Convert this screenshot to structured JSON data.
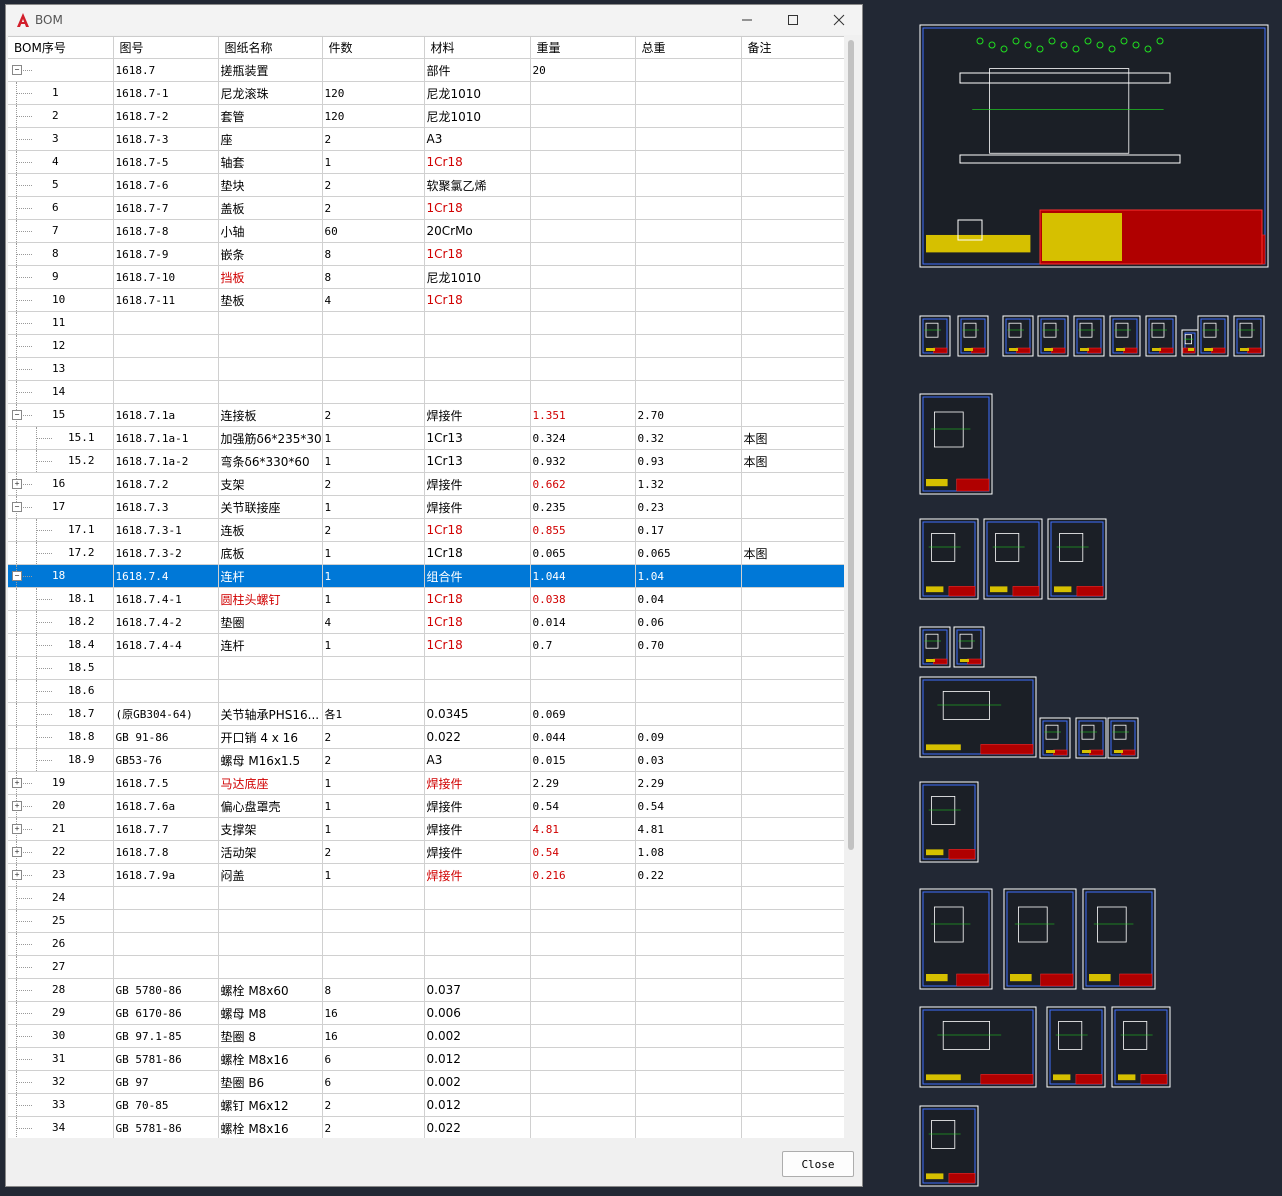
{
  "window": {
    "title": "BOM",
    "close_label": "Close"
  },
  "columns": [
    "BOM序号",
    "图号",
    "图纸名称",
    "件数",
    "材料",
    "重量",
    "总重",
    "备注"
  ],
  "rows": [
    {
      "lv": 0,
      "exp": "-",
      "seq": "",
      "dwg": "1618.7",
      "name": "搓瓶装置",
      "qty": "",
      "mat": "部件",
      "wt": "20",
      "tot": "",
      "note": ""
    },
    {
      "lv": 1,
      "seq": "1",
      "dwg": "1618.7-1",
      "name": "尼龙滚珠",
      "qty": "120",
      "mat": "尼龙1010",
      "wt": "",
      "tot": "",
      "note": ""
    },
    {
      "lv": 1,
      "seq": "2",
      "dwg": "1618.7-2",
      "name": "套管",
      "qty": "120",
      "mat": "尼龙1010",
      "wt": "",
      "tot": "",
      "note": ""
    },
    {
      "lv": 1,
      "seq": "3",
      "dwg": "1618.7-3",
      "name": "座",
      "qty": "2",
      "mat": "A3",
      "wt": "",
      "tot": "",
      "note": ""
    },
    {
      "lv": 1,
      "seq": "4",
      "dwg": "1618.7-5",
      "name": "轴套",
      "qty": "1",
      "mat": "1Cr18",
      "wt": "",
      "tot": "",
      "note": "",
      "red": [
        "mat"
      ]
    },
    {
      "lv": 1,
      "seq": "5",
      "dwg": "1618.7-6",
      "name": "垫块",
      "qty": "2",
      "mat": "软聚氯乙烯",
      "wt": "",
      "tot": "",
      "note": ""
    },
    {
      "lv": 1,
      "seq": "6",
      "dwg": "1618.7-7",
      "name": "盖板",
      "qty": "2",
      "mat": "1Cr18",
      "wt": "",
      "tot": "",
      "note": "",
      "red": [
        "mat"
      ]
    },
    {
      "lv": 1,
      "seq": "7",
      "dwg": "1618.7-8",
      "name": "小轴",
      "qty": "60",
      "mat": "20CrMo",
      "wt": "",
      "tot": "",
      "note": ""
    },
    {
      "lv": 1,
      "seq": "8",
      "dwg": "1618.7-9",
      "name": "嵌条",
      "qty": "8",
      "mat": "1Cr18",
      "wt": "",
      "tot": "",
      "note": "",
      "red": [
        "mat"
      ]
    },
    {
      "lv": 1,
      "seq": "9",
      "dwg": "1618.7-10",
      "name": "挡板",
      "qty": "8",
      "mat": "尼龙1010",
      "wt": "",
      "tot": "",
      "note": "",
      "red": [
        "name"
      ]
    },
    {
      "lv": 1,
      "seq": "10",
      "dwg": "1618.7-11",
      "name": "垫板",
      "qty": "4",
      "mat": "1Cr18",
      "wt": "",
      "tot": "",
      "note": "",
      "red": [
        "mat"
      ]
    },
    {
      "lv": 1,
      "seq": "11",
      "dwg": "",
      "name": "",
      "qty": "",
      "mat": "",
      "wt": "",
      "tot": "",
      "note": ""
    },
    {
      "lv": 1,
      "seq": "12",
      "dwg": "",
      "name": "",
      "qty": "",
      "mat": "",
      "wt": "",
      "tot": "",
      "note": ""
    },
    {
      "lv": 1,
      "seq": "13",
      "dwg": "",
      "name": "",
      "qty": "",
      "mat": "",
      "wt": "",
      "tot": "",
      "note": ""
    },
    {
      "lv": 1,
      "seq": "14",
      "dwg": "",
      "name": "",
      "qty": "",
      "mat": "",
      "wt": "",
      "tot": "",
      "note": ""
    },
    {
      "lv": 1,
      "exp": "-",
      "seq": "15",
      "dwg": "1618.7.1a",
      "name": "连接板",
      "qty": "2",
      "mat": "焊接件",
      "wt": "1.351",
      "tot": "2.70",
      "note": "",
      "red": [
        "wt"
      ]
    },
    {
      "lv": 2,
      "seq": "15.1",
      "dwg": "1618.7.1a-1",
      "name": "加强筋δ6*235*30",
      "qty": "1",
      "mat": "1Cr13",
      "wt": "0.324",
      "tot": "0.32",
      "note": "本图"
    },
    {
      "lv": 2,
      "seq": "15.2",
      "dwg": "1618.7.1a-2",
      "name": "弯条δ6*330*60",
      "qty": "1",
      "mat": "1Cr13",
      "wt": "0.932",
      "tot": "0.93",
      "note": "本图"
    },
    {
      "lv": 1,
      "exp": "+",
      "seq": "16",
      "dwg": "1618.7.2",
      "name": "支架",
      "qty": "2",
      "mat": "焊接件",
      "wt": "0.662",
      "tot": "1.32",
      "note": "",
      "red": [
        "wt"
      ]
    },
    {
      "lv": 1,
      "exp": "-",
      "seq": "17",
      "dwg": "1618.7.3",
      "name": "关节联接座",
      "qty": "1",
      "mat": "焊接件",
      "wt": "0.235",
      "tot": "0.23",
      "note": ""
    },
    {
      "lv": 2,
      "seq": "17.1",
      "dwg": "1618.7.3-1",
      "name": "连板",
      "qty": "2",
      "mat": "1Cr18",
      "wt": "0.855",
      "tot": "0.17",
      "note": "",
      "red": [
        "mat",
        "wt"
      ]
    },
    {
      "lv": 2,
      "seq": "17.2",
      "dwg": "1618.7.3-2",
      "name": "底板",
      "qty": "1",
      "mat": "1Cr18",
      "wt": "0.065",
      "tot": "0.065",
      "note": "本图"
    },
    {
      "lv": 1,
      "exp": "-",
      "sel": true,
      "seq": "18",
      "dwg": "1618.7.4",
      "name": "连杆",
      "qty": "1",
      "mat": "组合件",
      "wt": "1.044",
      "tot": "1.04",
      "note": ""
    },
    {
      "lv": 2,
      "seq": "18.1",
      "dwg": "1618.7.4-1",
      "name": "圆柱头螺钉",
      "qty": "1",
      "mat": "1Cr18",
      "wt": "0.038",
      "tot": "0.04",
      "note": "",
      "red": [
        "name",
        "mat",
        "wt"
      ]
    },
    {
      "lv": 2,
      "seq": "18.2",
      "dwg": "1618.7.4-2",
      "name": "垫圈",
      "qty": "4",
      "mat": "1Cr18",
      "wt": "0.014",
      "tot": "0.06",
      "note": "",
      "red": [
        "mat"
      ]
    },
    {
      "lv": 2,
      "seq": "18.4",
      "dwg": "1618.7.4-4",
      "name": "连杆",
      "qty": "1",
      "mat": "1Cr18",
      "wt": "0.7",
      "tot": "0.70",
      "note": "",
      "red": [
        "mat"
      ]
    },
    {
      "lv": 2,
      "seq": "18.5",
      "dwg": "",
      "name": "",
      "qty": "",
      "mat": "",
      "wt": "",
      "tot": "",
      "note": ""
    },
    {
      "lv": 2,
      "seq": "18.6",
      "dwg": "",
      "name": "",
      "qty": "",
      "mat": "",
      "wt": "",
      "tot": "",
      "note": ""
    },
    {
      "lv": 2,
      "seq": "18.7",
      "dwg": "(原GB304-64)",
      "name": "关节轴承PHS16...",
      "qty": "各1",
      "mat": "0.0345",
      "wt": "0.069",
      "tot": "",
      "note": ""
    },
    {
      "lv": 2,
      "seq": "18.8",
      "dwg": "GB 91-86",
      "name": "开口销 4 x 16",
      "qty": "2",
      "mat": "0.022",
      "wt": "0.044",
      "tot": "0.09",
      "note": ""
    },
    {
      "lv": 2,
      "seq": "18.9",
      "dwg": "GB53-76",
      "name": "螺母 M16x1.5",
      "qty": "2",
      "mat": "A3",
      "wt": "0.015",
      "tot": "0.03",
      "note": ""
    },
    {
      "lv": 1,
      "exp": "+",
      "seq": "19",
      "dwg": "1618.7.5",
      "name": "马达底座",
      "qty": "1",
      "mat": "焊接件",
      "wt": "2.29",
      "tot": "2.29",
      "note": "",
      "red": [
        "name",
        "mat"
      ]
    },
    {
      "lv": 1,
      "exp": "+",
      "seq": "20",
      "dwg": "1618.7.6a",
      "name": "偏心盘罩壳",
      "qty": "1",
      "mat": "焊接件",
      "wt": "0.54",
      "tot": "0.54",
      "note": ""
    },
    {
      "lv": 1,
      "exp": "+",
      "seq": "21",
      "dwg": "1618.7.7",
      "name": "支撑架",
      "qty": "1",
      "mat": "焊接件",
      "wt": "4.81",
      "tot": "4.81",
      "note": "",
      "red": [
        "wt"
      ]
    },
    {
      "lv": 1,
      "exp": "+",
      "seq": "22",
      "dwg": "1618.7.8",
      "name": "活动架",
      "qty": "2",
      "mat": "焊接件",
      "wt": "0.54",
      "tot": "1.08",
      "note": "",
      "red": [
        "wt"
      ]
    },
    {
      "lv": 1,
      "exp": "+",
      "seq": "23",
      "dwg": "1618.7.9a",
      "name": "闷盖",
      "qty": "1",
      "mat": "焊接件",
      "wt": "0.216",
      "tot": "0.22",
      "note": "",
      "red": [
        "mat",
        "wt"
      ]
    },
    {
      "lv": 1,
      "seq": "24",
      "dwg": "",
      "name": "",
      "qty": "",
      "mat": "",
      "wt": "",
      "tot": "",
      "note": ""
    },
    {
      "lv": 1,
      "seq": "25",
      "dwg": "",
      "name": "",
      "qty": "",
      "mat": "",
      "wt": "",
      "tot": "",
      "note": ""
    },
    {
      "lv": 1,
      "seq": "26",
      "dwg": "",
      "name": "",
      "qty": "",
      "mat": "",
      "wt": "",
      "tot": "",
      "note": ""
    },
    {
      "lv": 1,
      "seq": "27",
      "dwg": "",
      "name": "",
      "qty": "",
      "mat": "",
      "wt": "",
      "tot": "",
      "note": ""
    },
    {
      "lv": 1,
      "seq": "28",
      "dwg": "GB 5780-86",
      "name": "螺栓  M8x60",
      "qty": "8",
      "mat": "0.037",
      "wt": "",
      "tot": "",
      "note": ""
    },
    {
      "lv": 1,
      "seq": "29",
      "dwg": "GB 6170-86",
      "name": "螺母 M8",
      "qty": "16",
      "mat": "0.006",
      "wt": "",
      "tot": "",
      "note": ""
    },
    {
      "lv": 1,
      "seq": "30",
      "dwg": "GB 97.1-85",
      "name": "垫圈 8",
      "qty": "16",
      "mat": "0.002",
      "wt": "",
      "tot": "",
      "note": ""
    },
    {
      "lv": 1,
      "seq": "31",
      "dwg": "GB 5781-86",
      "name": "螺栓  M8x16",
      "qty": "6",
      "mat": "0.012",
      "wt": "",
      "tot": "",
      "note": ""
    },
    {
      "lv": 1,
      "seq": "32",
      "dwg": "GB 97",
      "name": "垫圈 B6",
      "qty": "6",
      "mat": "0.002",
      "wt": "",
      "tot": "",
      "note": ""
    },
    {
      "lv": 1,
      "seq": "33",
      "dwg": "GB 70-85",
      "name": "螺钉 M6x12",
      "qty": "2",
      "mat": "0.012",
      "wt": "",
      "tot": "",
      "note": ""
    },
    {
      "lv": 1,
      "seq": "34",
      "dwg": "GB 5781-86",
      "name": "螺栓  M8x16",
      "qty": "2",
      "mat": "0.022",
      "wt": "",
      "tot": "",
      "note": ""
    }
  ]
}
